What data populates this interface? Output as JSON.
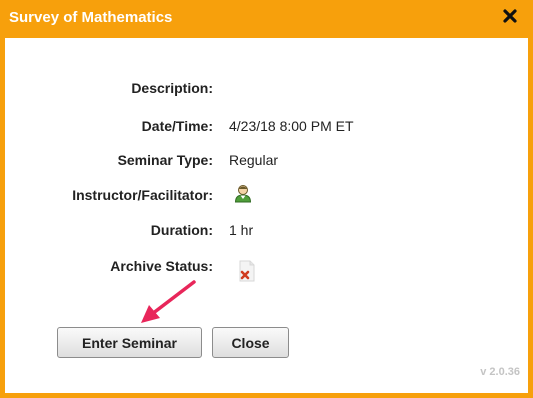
{
  "dialog": {
    "title": "Survey of Mathematics",
    "version": "v 2.0.36"
  },
  "fields": [
    {
      "label": "Description:",
      "value": ""
    },
    {
      "label": "Date/Time:",
      "value": "4/23/18 8:00 PM ET"
    },
    {
      "label": "Seminar Type:",
      "value": "Regular"
    },
    {
      "label": "Instructor/Facilitator:",
      "icon": "person-icon"
    },
    {
      "label": "Duration:",
      "value": "1 hr"
    },
    {
      "label": "Archive Status:",
      "icon": "archive-unavailable-icon"
    }
  ],
  "buttons": {
    "enter_label": "Enter Seminar",
    "close_label": "Close"
  },
  "colors": {
    "accent": "#f7a00c",
    "annotation_arrow": "#e8265a"
  }
}
